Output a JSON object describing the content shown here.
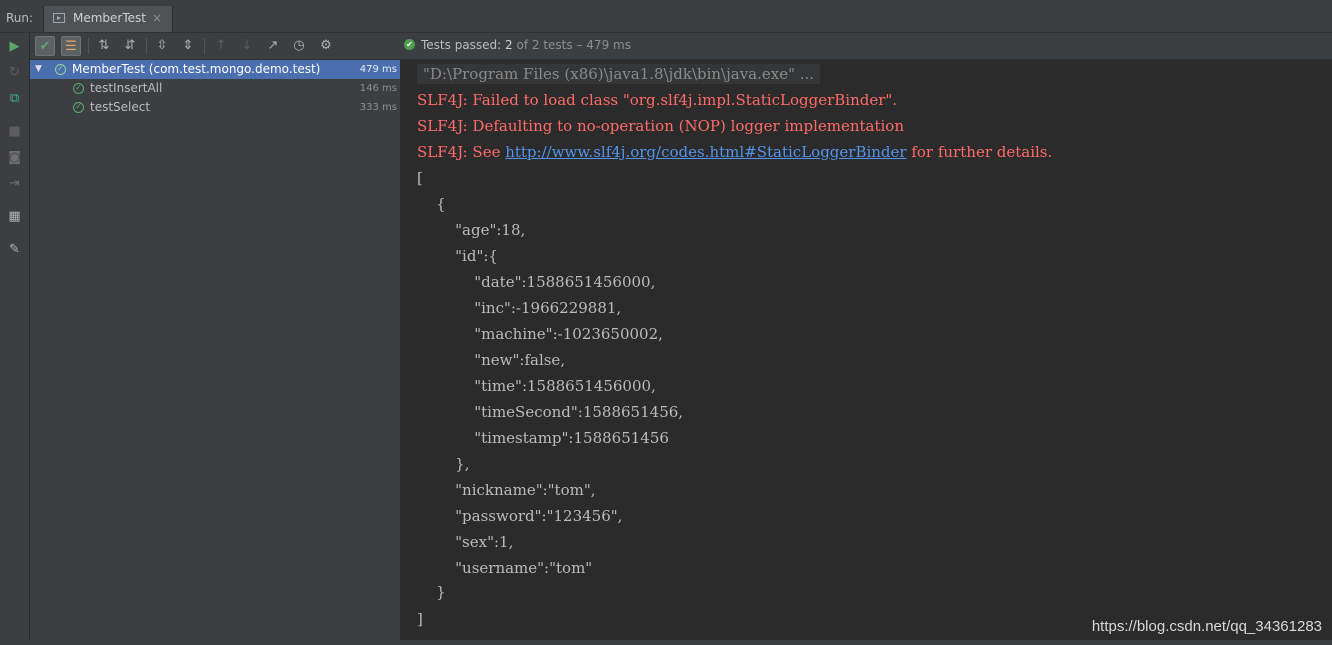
{
  "run_panel": {
    "label": "Run:",
    "tab_title": "MemberTest",
    "tab_close": "×"
  },
  "status": {
    "prefix": "Tests passed:",
    "count": "2",
    "suffix": "of 2 tests",
    "duration": "– 479 ms"
  },
  "tree": [
    {
      "label": "MemberTest (com.test.mongo.demo.test)",
      "time": "479 ms",
      "selected": true
    },
    {
      "label": "testInsertAll",
      "time": "146 ms",
      "selected": false
    },
    {
      "label": "testSelect",
      "time": "333 ms",
      "selected": false
    }
  ],
  "console": {
    "command": "\"D:\\Program Files (x86)\\java1.8\\jdk\\bin\\java.exe\" ...",
    "errors": {
      "line1": "SLF4J: Failed to load class \"org.slf4j.impl.StaticLoggerBinder\".",
      "line2": "SLF4J: Defaulting to no-operation (NOP) logger implementation",
      "line3_prefix": "SLF4J: See ",
      "line3_link": "http://www.slf4j.org/codes.html#StaticLoggerBinder",
      "line3_suffix": " for further details."
    },
    "output": [
      "[",
      "    {",
      "        \"age\":18,",
      "        \"id\":{",
      "            \"date\":1588651456000,",
      "            \"inc\":-1966229881,",
      "            \"machine\":-1023650002,",
      "            \"new\":false,",
      "            \"time\":1588651456000,",
      "            \"timeSecond\":1588651456,",
      "            \"timestamp\":1588651456",
      "        },",
      "        \"nickname\":\"tom\",",
      "        \"password\":\"123456\",",
      "        \"sex\":1,",
      "        \"username\":\"tom\"",
      "    }",
      "]"
    ]
  },
  "watermark": "https://blog.csdn.net/qq_34361283",
  "colors": {
    "pass": "#59a869",
    "error_text": "#ff6b68",
    "link": "#5394ec",
    "selection": "#4b6eaf"
  },
  "icons": {
    "left": [
      "run-icon",
      "rerun-failed-icon",
      "toggle-auto-test-icon",
      "stop-icon",
      "camera-icon",
      "exit-icon",
      "layout-icon",
      "pin-icon"
    ],
    "toolbar": [
      "show-passed-icon",
      "show-ignored-icon",
      "sort-alpha-icon",
      "sort-duration-icon",
      "expand-all-icon",
      "collapse-all-icon",
      "previous-test-icon",
      "next-test-icon",
      "export-icon",
      "history-icon",
      "settings-icon"
    ]
  }
}
